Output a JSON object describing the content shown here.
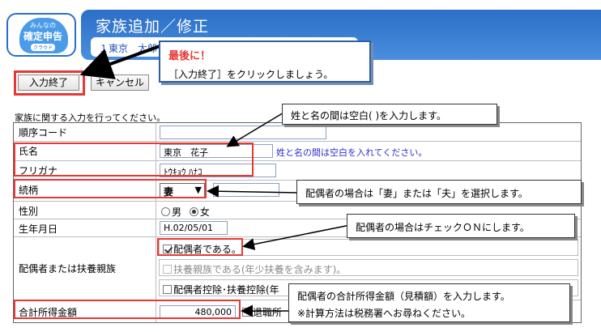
{
  "header": {
    "logo_line1": "みんなの",
    "logo_line2": "確定申告",
    "logo_line3": "クラウド",
    "title": "家族追加／修正",
    "sub": "１東京　太郎"
  },
  "toolbar": {
    "done_label": "入力終了",
    "cancel_label": "キャンセル"
  },
  "form": {
    "intro": "家族に関する入力を行ってください。",
    "rows": {
      "code": {
        "label": "順序コード",
        "value": ""
      },
      "name": {
        "label": "氏名",
        "value": "東京　花子",
        "hint": "姓と名の間は空白を入れてください。"
      },
      "kana": {
        "label": "フリガナ",
        "value": "ﾄｳｷｮｳ ﾊﾅｺ"
      },
      "relation": {
        "label": "続柄",
        "value": "妻"
      },
      "gender": {
        "label": "性別",
        "male": "男",
        "female": "女",
        "selected": "女"
      },
      "birth": {
        "label": "生年月日",
        "value": "H.02/05/01"
      },
      "spouse": {
        "label": "配偶者または扶養親族",
        "opt_spouse": "配偶者である。",
        "opt_dependent": "扶養親族である(年少扶養を含みます)。",
        "opt_deduction": "配偶者控除･扶養控除(年"
      },
      "income": {
        "label": "合計所得金額",
        "value": "480,000",
        "retire": "退職所"
      }
    }
  },
  "callouts": {
    "main_title": "最後に！",
    "main_body": "［入力終了］をクリックしましょう。",
    "name": "姓と名の間は空白(  )を入力します。",
    "relation": "配偶者の場合は「妻」または「夫」を選択します。",
    "check": "配偶者の場合はチェックＯＮにします。",
    "income_1": "配偶者の合計所得金額（見積額）を入力します。",
    "income_2": "※計算方法は税務署へお尋ねください。"
  },
  "colors": {
    "brand": "#2b6fc6",
    "highlight": "#e53935",
    "hint": "#2c2cd0"
  }
}
